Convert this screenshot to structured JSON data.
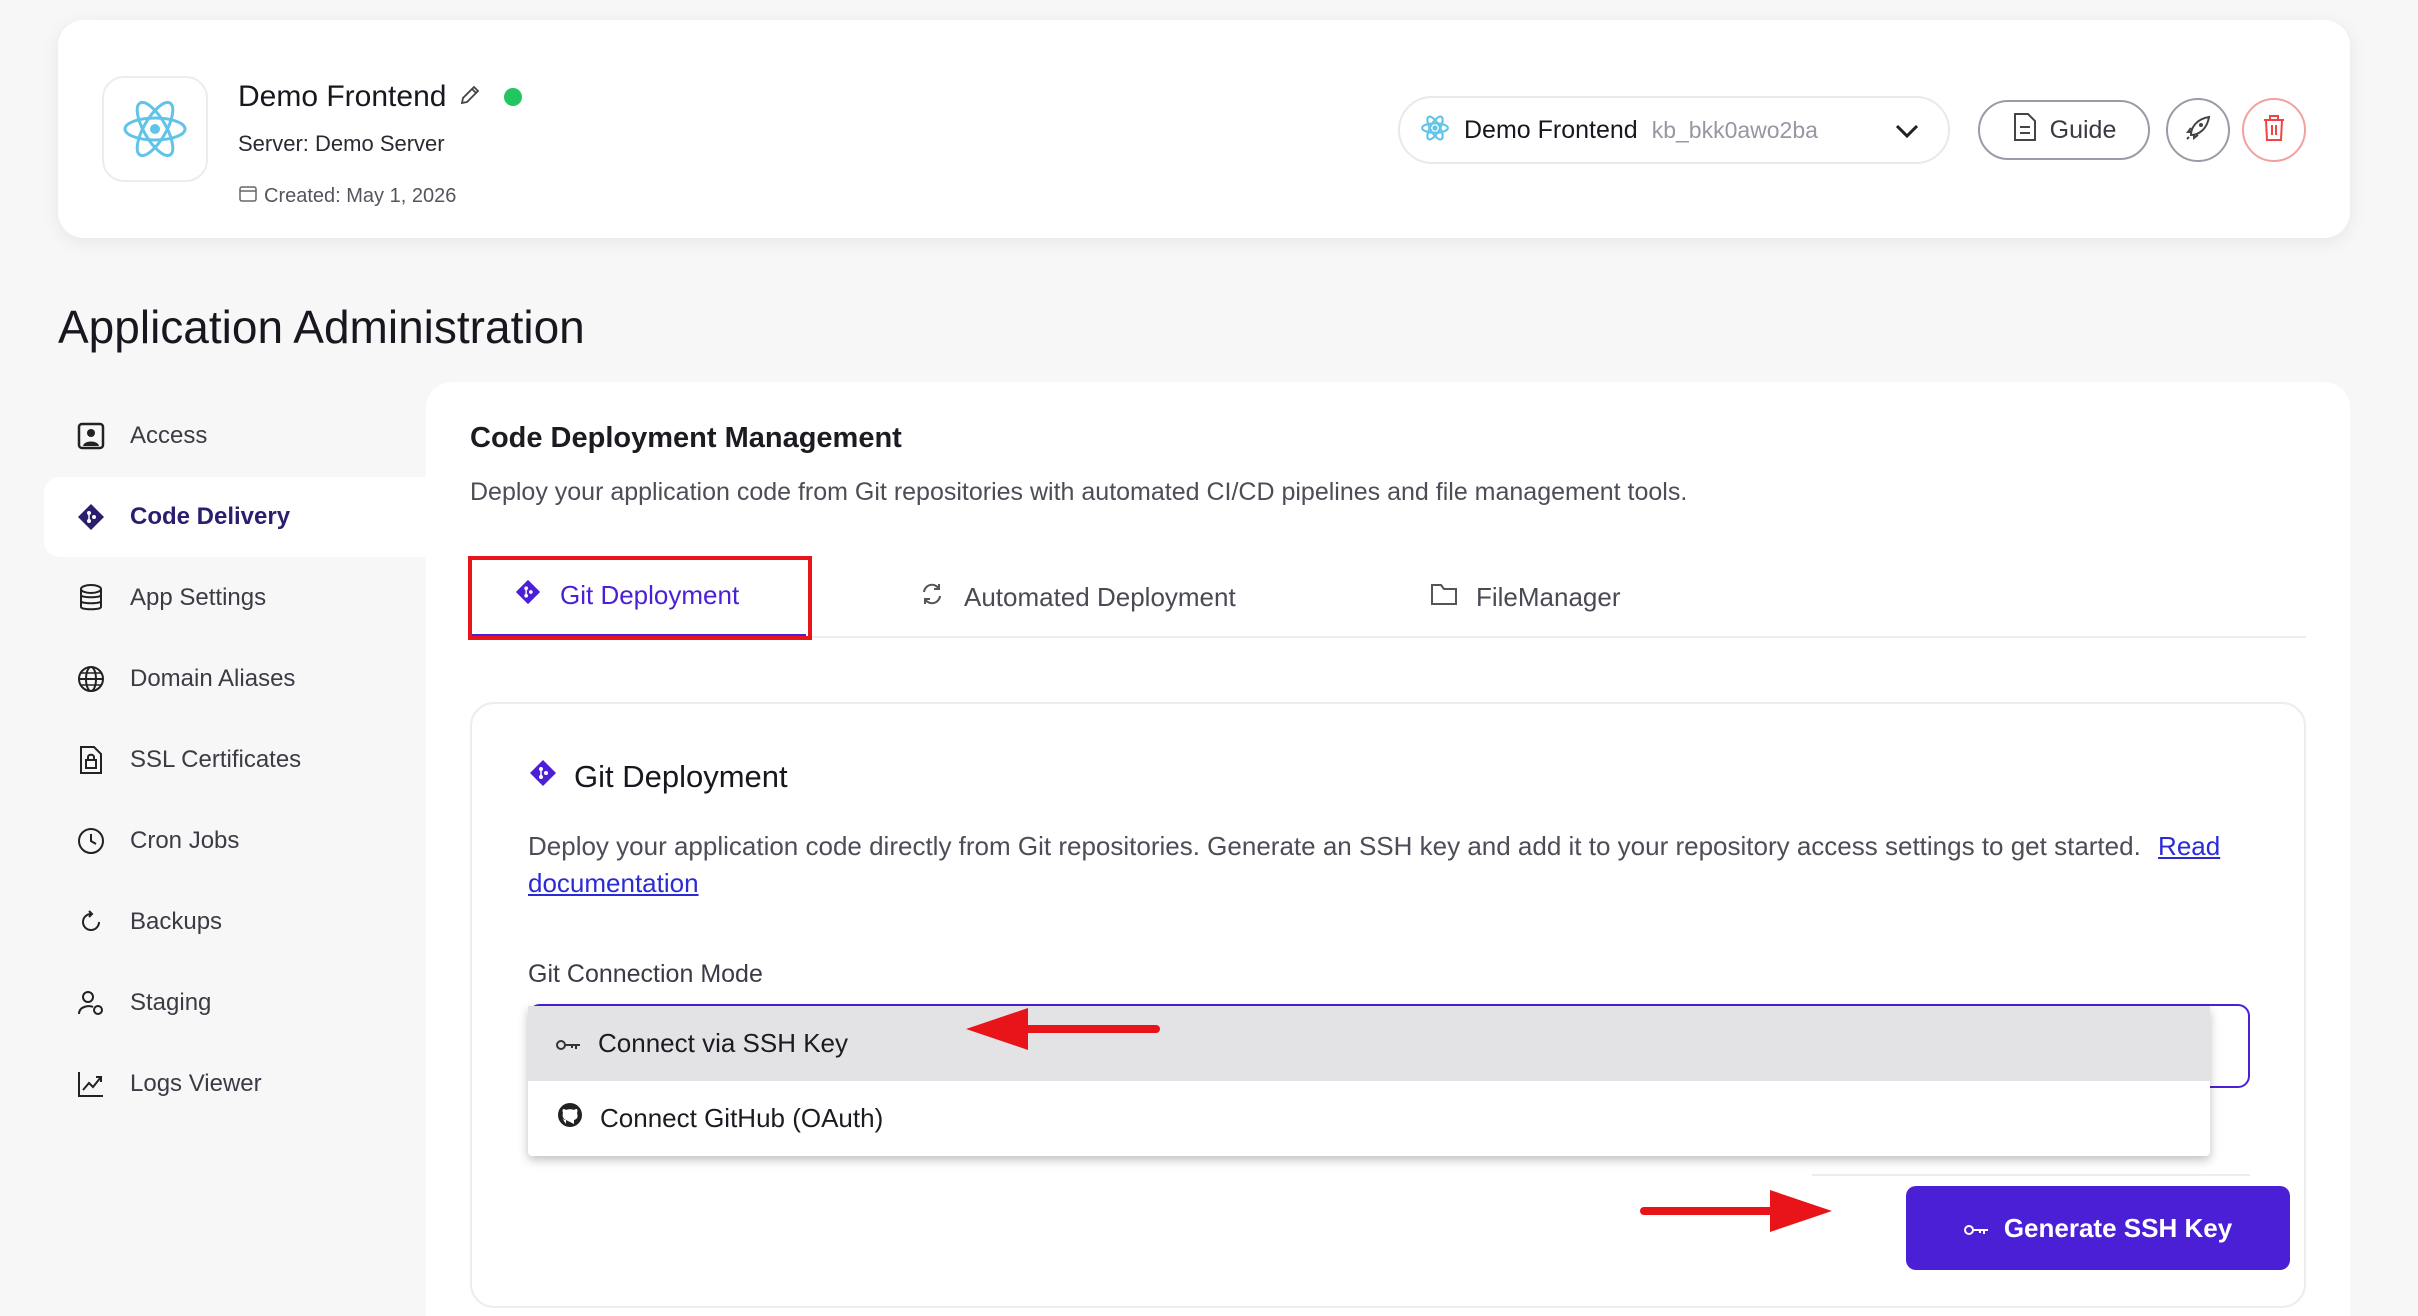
{
  "header": {
    "app_name": "Demo Frontend",
    "server": "Server: Demo Server",
    "created": "Created: May 1, 2026",
    "status_color": "#22c55e",
    "switcher": {
      "name": "Demo Frontend",
      "id": "kb_bkk0awo2ba"
    },
    "guide_label": "Guide"
  },
  "page_title": "Application Administration",
  "sidebar": {
    "items": [
      {
        "label": "Access",
        "icon": "user-square-icon"
      },
      {
        "label": "Code Delivery",
        "icon": "git-icon",
        "active": true
      },
      {
        "label": "App Settings",
        "icon": "database-icon"
      },
      {
        "label": "Domain Aliases",
        "icon": "globe-icon"
      },
      {
        "label": "SSL Certificates",
        "icon": "lock-file-icon"
      },
      {
        "label": "Cron Jobs",
        "icon": "clock-icon"
      },
      {
        "label": "Backups",
        "icon": "refresh-icon"
      },
      {
        "label": "Staging",
        "icon": "user-settings-icon"
      },
      {
        "label": "Logs Viewer",
        "icon": "chart-line-icon"
      }
    ]
  },
  "main": {
    "title": "Code Deployment Management",
    "description": "Deploy your application code from Git repositories with automated CI/CD pipelines and file management tools.",
    "tabs": [
      {
        "label": "Git Deployment",
        "active": true
      },
      {
        "label": "Automated Deployment"
      },
      {
        "label": "FileManager"
      }
    ],
    "git_card": {
      "title": "Git Deployment",
      "description": "Deploy your application code directly from Git repositories. Generate an SSH key and add it to your repository access settings to get started.",
      "doc_link": "Read documentation",
      "mode_label": "Git Connection Mode",
      "options": [
        {
          "label": "Connect via SSH Key",
          "selected": true
        },
        {
          "label": "Connect GitHub (OAuth)"
        }
      ],
      "generate_label": "Generate SSH Key"
    }
  },
  "colors": {
    "accent": "#4b1fd6",
    "annotation": "#e8141a",
    "danger": "#ef4444"
  }
}
